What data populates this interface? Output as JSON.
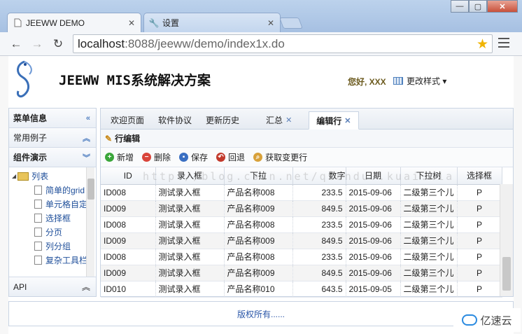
{
  "browser": {
    "tabs": [
      {
        "label": "JEEWW DEMO",
        "icon": "page-icon"
      },
      {
        "label": "设置",
        "icon": "wrench-icon"
      }
    ],
    "window_controls": {
      "minimize": "—",
      "maximize": "▢",
      "close": "✕"
    },
    "address": {
      "host": "localhost",
      "rest": ":8088/jeeww/demo/index1x.do"
    }
  },
  "header": {
    "title": "JEEWW MIS系统解决方案",
    "greeting": "您好, XXX",
    "style_menu": "更改样式 ▾"
  },
  "sidebar": {
    "menu_title": "菜单信息",
    "sections": [
      "常用例子",
      "组件演示"
    ],
    "tree": {
      "folder": "列表",
      "items": [
        "简单的grid",
        "单元格自定",
        "选择框",
        "分页",
        "列分组",
        "复杂工具栏"
      ]
    },
    "api": "API"
  },
  "main": {
    "tabs": [
      {
        "label": "欢迎页面",
        "closable": false,
        "active": false
      },
      {
        "label": "软件协议",
        "closable": false,
        "active": false
      },
      {
        "label": "更新历史",
        "closable": false,
        "active": false
      },
      {
        "label": "汇总",
        "closable": true,
        "active": false
      },
      {
        "label": "编辑行",
        "closable": true,
        "active": true
      }
    ],
    "panel_title": "行编辑",
    "actions": [
      {
        "label": "新增",
        "icon": "add-icon",
        "color": "#3aa63a",
        "glyph": "+"
      },
      {
        "label": "删除",
        "icon": "remove-icon",
        "color": "#d9443a",
        "glyph": "−"
      },
      {
        "label": "保存",
        "icon": "save-icon",
        "color": "#3a6fc2",
        "glyph": "▪"
      },
      {
        "label": "回退",
        "icon": "undo-icon",
        "color": "#c2392b",
        "glyph": "↶"
      },
      {
        "label": "获取变更行",
        "icon": "search-icon",
        "color": "#d8a13a",
        "glyph": "⌕"
      }
    ],
    "grid": {
      "columns": [
        "ID",
        "录入框",
        "下拉",
        "数字",
        "日期",
        "下拉树",
        "选择框"
      ],
      "rows": [
        [
          "ID008",
          "测试录入框",
          "产品名称008",
          "233.5",
          "2015-09-06",
          "二级第三个儿",
          "P"
        ],
        [
          "ID009",
          "测试录入框",
          "产品名称009",
          "849.5",
          "2015-09-06",
          "二级第三个儿",
          "P"
        ],
        [
          "ID008",
          "测试录入框",
          "产品名称008",
          "233.5",
          "2015-09-06",
          "二级第三个儿",
          "P"
        ],
        [
          "ID009",
          "测试录入框",
          "产品名称009",
          "849.5",
          "2015-09-06",
          "二级第三个儿",
          "P"
        ],
        [
          "ID008",
          "测试录入框",
          "产品名称008",
          "233.5",
          "2015-09-06",
          "二级第三个儿",
          "P"
        ],
        [
          "ID009",
          "测试录入框",
          "产品名称009",
          "849.5",
          "2015-09-06",
          "二级第三个儿",
          "P"
        ],
        [
          "ID010",
          "测试录入框",
          "产品名称010",
          "643.5",
          "2015-09-05",
          "二级第三个儿",
          "P"
        ]
      ],
      "watermark": "http://blog.csdn.net/qiandu..kuai.hia"
    }
  },
  "footer": {
    "copyright": "版权所有......"
  },
  "brand": {
    "label": "亿速云"
  }
}
